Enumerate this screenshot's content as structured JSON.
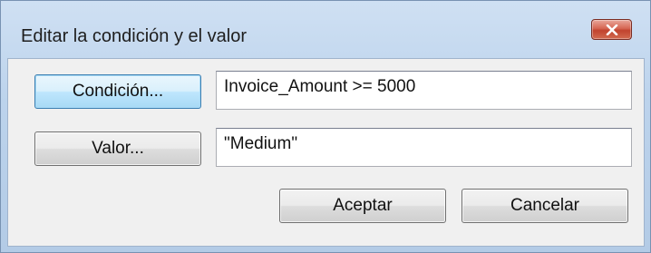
{
  "window": {
    "title": "Editar la condición y el valor"
  },
  "buttons": {
    "condition": "Condición...",
    "value": "Valor...",
    "accept": "Aceptar",
    "cancel": "Cancelar"
  },
  "fields": {
    "condition_value": "Invoice_Amount >= 5000",
    "value_value": "\"Medium\""
  },
  "icons": {
    "close": "close-icon"
  },
  "colors": {
    "close_button": "#c94a34",
    "focus_button": "#a7d9f5",
    "frame": "#bcd3ec",
    "client_bg": "#f0f0f0"
  }
}
